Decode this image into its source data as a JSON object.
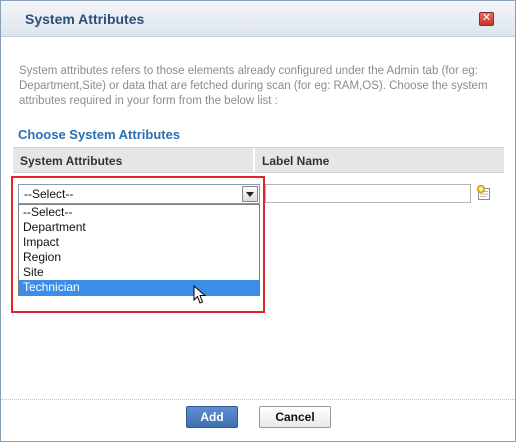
{
  "dialog": {
    "title": "System Attributes",
    "close_icon": "close-icon",
    "description": "System attributes refers to those elements already configured under the Admin tab (for eg: Department,Site) or data that are fetched during scan (for eg: RAM,OS). Choose the system attributes required in your form from the below list :",
    "section_heading": "Choose System Attributes"
  },
  "table": {
    "columns": [
      "System Attributes",
      "Label Name"
    ]
  },
  "attribute_select": {
    "value": "--Select--",
    "options": [
      "--Select--",
      "Department",
      "Impact",
      "Region",
      "Site",
      "Technician"
    ],
    "highlighted_option": "Technician",
    "expanded": true
  },
  "label_input": {
    "value": "",
    "add_icon": "add-label-icon"
  },
  "footer": {
    "add_label": "Add",
    "cancel_label": "Cancel"
  },
  "colors": {
    "title": "#2b4f7a",
    "section_heading": "#2a6fb0",
    "highlight_border": "#e0262b",
    "selected_option": "#3a8ee6",
    "add_button": "#3e6fb2"
  }
}
